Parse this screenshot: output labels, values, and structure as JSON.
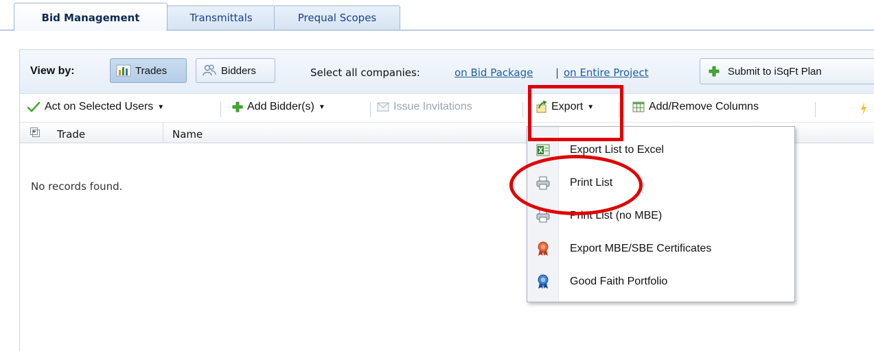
{
  "tabs": [
    {
      "label": "Bid Management",
      "active": true
    },
    {
      "label": "Transmittals",
      "active": false
    },
    {
      "label": "Prequal Scopes",
      "active": false
    }
  ],
  "viewbar": {
    "view_by_label": "View by:",
    "trades_label": "Trades",
    "bidders_label": "Bidders",
    "select_all_label": "Select all companies:",
    "bid_package_link": "on Bid Package",
    "separator": "|",
    "entire_project_link": "on Entire Project",
    "submit_label": "Submit to iSqFt Plan"
  },
  "toolbar": {
    "act_label": "Act on Selected Users",
    "add_bidder_label": "Add Bidder(s)",
    "issue_label": "Issue Invitations",
    "export_label": "Export",
    "columns_label": "Add/Remove Columns"
  },
  "grid": {
    "columns": [
      "Trade",
      "Name"
    ],
    "empty_text": "No records found."
  },
  "export_menu": {
    "items": [
      {
        "label": "Export List to Excel",
        "icon": "excel-icon"
      },
      {
        "label": "Print List",
        "icon": "printer-icon"
      },
      {
        "label": "Print List (no MBE)",
        "icon": "printer-icon"
      },
      {
        "label": "Export MBE/SBE Certificates",
        "icon": "ribbon-award-icon"
      },
      {
        "label": "Good Faith Portfolio",
        "icon": "ribbon-award-icon"
      }
    ]
  },
  "colors": {
    "tab_text": "#15428b",
    "link": "#1f5e9e",
    "annotation": "#e00000",
    "plus_green": "#3fae2a"
  }
}
